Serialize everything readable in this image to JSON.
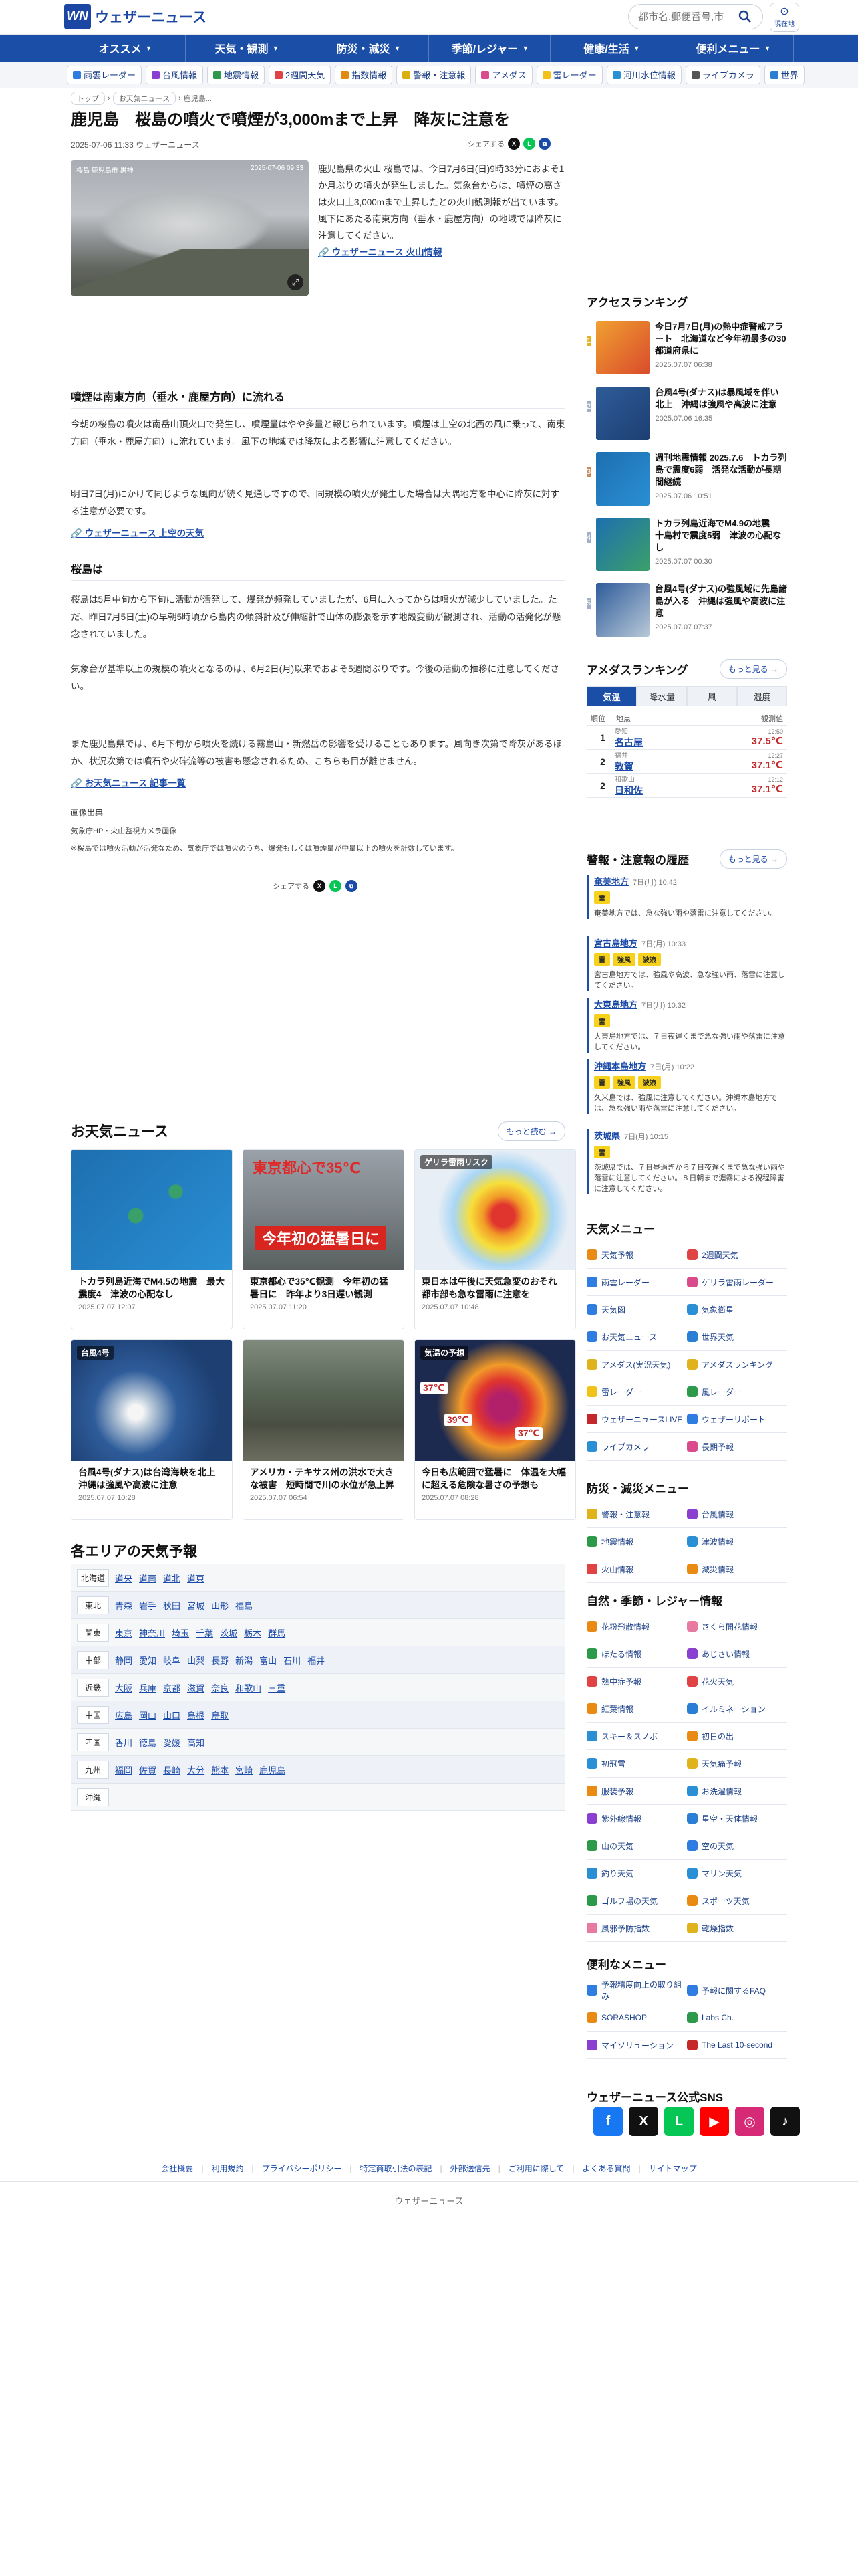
{
  "header": {
    "logo_mark": "WN",
    "logo_text": "ウェザーニュース",
    "search_placeholder": "都市名,郵便番号,市",
    "current_location_label": "現在地"
  },
  "nav": [
    "オススメ",
    "天気・観測",
    "防災・減災",
    "季節/レジャー",
    "健康/生活",
    "便利メニュー"
  ],
  "subnav": [
    {
      "label": "雨雲レーダー",
      "color": "#2f7de1"
    },
    {
      "label": "台風情報",
      "color": "#8a3fd1"
    },
    {
      "label": "地震情報",
      "color": "#2d9a4b"
    },
    {
      "label": "2週間天気",
      "color": "#e04343"
    },
    {
      "label": "指数情報",
      "color": "#e08a12"
    },
    {
      "label": "警報・注意報",
      "color": "#d9b00f"
    },
    {
      "label": "アメダス",
      "color": "#d94b8c"
    },
    {
      "label": "雷レーダー",
      "color": "#f2c21a"
    },
    {
      "label": "河川水位情報",
      "color": "#2a8fd4"
    },
    {
      "label": "ライブカメラ",
      "color": "#555555"
    },
    {
      "label": "世界",
      "color": "#2a7fd4"
    }
  ],
  "breadcrumb": [
    "トップ",
    "お天気ニュース",
    "鹿児島..."
  ],
  "article": {
    "title": "鹿児島　桜島の噴火で噴煙が3,000mまで上昇　降灰に注意を",
    "meta": "2025-07-06 11:33 ウェザーニュース",
    "share_label": "シェアする",
    "image_label": "桜島 鹿児島市 黒神",
    "image_time": "2025-07-06 09:33",
    "lead": "鹿児島県の火山 桜島では、今日7月6日(日)9時33分におよそ1か月ぶりの噴火が発生しました。気象台からは、噴煙の高さは火口上3,000mまで上昇したとの火山観測報が出ています。風下にあたる南東方向（垂水・鹿屋方向）の地域では降灰に注意してください。",
    "lead_link": "ウェザーニュース 火山情報",
    "section1_title": "噴煙は南東方向（垂水・鹿屋方向）に流れる",
    "section1_p1": "今朝の桜島の噴火は南岳山頂火口で発生し、噴煙量はやや多量と報じられています。噴煙は上空の北西の風に乗って、南東方向（垂水・鹿屋方向）に流れています。風下の地域では降灰による影響に注意してください。",
    "section1_p2": "明日7日(月)にかけて同じような風向が続く見通しですので、同規模の噴火が発生した場合は大隅地方を中心に降灰に対する注意が必要です。",
    "section1_link": "ウェザーニュース 上空の天気",
    "section2_title": "桜島は",
    "section2_p1": "桜島は5月中旬から下旬に活動が活発して、爆発が頻発していましたが、6月に入ってからは噴火が減少していました。ただ、昨日7月5日(土)の早朝5時頃から島内の傾斜計及び伸縮計で山体の膨張を示す地殻変動が観測され、活動の活発化が懸念されていました。",
    "section2_p2": "気象台が基準以上の規模の噴火となるのは、6月2日(月)以来でおよそ5週間ぶりです。今後の活動の推移に注意してください。",
    "section2_p3": "また鹿児島県では、6月下旬から噴火を続ける霧島山・新燃岳の影響を受けることもあります。風向き次第で降灰があるほか、状況次第では噴石や火砕流等の被害も懸念されるため、こちらも目が離せません。",
    "section2_link": "お天気ニュース 記事一覧",
    "credit_title": "画像出典",
    "credit": "気象庁HP・火山監視カメラ画像",
    "note": "※桜島では噴火活動が活発なため、気象庁では噴火のうち、爆発もしくは噴煙量が中量以上の噴火を計数しています。"
  },
  "news": {
    "title": "お天気ニュース",
    "more": "もっと読む",
    "items": [
      {
        "title": "トカラ列島近海でM4.5の地震　最大震度4　津波の心配なし",
        "date": "2025.07.07 12:07",
        "theme": "map"
      },
      {
        "title": "東京都心で35℃観測　今年初の猛暑日に　昨年より3日遅い観測",
        "date": "2025.07.07 11:20",
        "theme": "city",
        "overlay": "東京都心で35℃",
        "banner": "今年初の猛暑日に"
      },
      {
        "title": "東日本は午後に天気急変のおそれ　都市部も急な雷雨に注意を",
        "date": "2025.07.07 10:48",
        "theme": "rainmap",
        "overlay": "ゲリラ雷雨リスク"
      },
      {
        "title": "台風4号(ダナス)は台湾海峡を北上　沖縄は強風や高波に注意",
        "date": "2025.07.07 10:28",
        "theme": "typhoon",
        "overlay": "台風4号"
      },
      {
        "title": "アメリカ・テキサス州の洪水で大きな被害　短時間で川の水位が急上昇",
        "date": "2025.07.07 06:54",
        "theme": "flood"
      },
      {
        "title": "今日も広範囲で猛暑に　体温を大幅に超える危険な暑さの予想も",
        "date": "2025.07.07 08:28",
        "theme": "heatmap",
        "overlay": "気温の予想",
        "t1": "37℃",
        "t2": "39℃",
        "t3": "37℃"
      }
    ]
  },
  "areas": {
    "title": "各エリアの天気予報",
    "rows": [
      {
        "region": "北海道",
        "prefs": [
          "道央",
          "道南",
          "道北",
          "道東"
        ]
      },
      {
        "region": "東北",
        "prefs": [
          "青森",
          "岩手",
          "秋田",
          "宮城",
          "山形",
          "福島"
        ]
      },
      {
        "region": "関東",
        "prefs": [
          "東京",
          "神奈川",
          "埼玉",
          "千葉",
          "茨城",
          "栃木",
          "群馬"
        ]
      },
      {
        "region": "中部",
        "prefs": [
          "静岡",
          "愛知",
          "岐阜",
          "山梨",
          "長野",
          "新潟",
          "富山",
          "石川",
          "福井"
        ]
      },
      {
        "region": "近畿",
        "prefs": [
          "大阪",
          "兵庫",
          "京都",
          "滋賀",
          "奈良",
          "和歌山",
          "三重"
        ]
      },
      {
        "region": "中国",
        "prefs": [
          "広島",
          "岡山",
          "山口",
          "島根",
          "鳥取"
        ]
      },
      {
        "region": "四国",
        "prefs": [
          "香川",
          "徳島",
          "愛媛",
          "高知"
        ]
      },
      {
        "region": "九州",
        "prefs": [
          "福岡",
          "佐賀",
          "長崎",
          "大分",
          "熊本",
          "宮崎",
          "鹿児島"
        ]
      },
      {
        "region": "沖縄",
        "prefs": []
      }
    ]
  },
  "ranking": {
    "title": "アクセスランキング",
    "items": [
      {
        "rank": "1",
        "title": "今日7月7日(月)の熱中症警戒アラート　北海道など今年初最多の30都道府県に",
        "date": "2025.07.07 06:38",
        "color": "#e0b21b"
      },
      {
        "rank": "2",
        "title": "台風4号(ダナス)は暴風域を伴い北上　沖縄は強風や高波に注意",
        "date": "2025.07.06 16:35",
        "color": "#9fb0c8"
      },
      {
        "rank": "3",
        "title": "週刊地震情報 2025.7.6　トカラ列島で震度6弱　活発な活動が長期間継続",
        "date": "2025.07.06 10:51",
        "color": "#c98b5a"
      },
      {
        "rank": "4",
        "title": "トカラ列島近海でM4.9の地震　十島村で震度5弱　津波の心配なし",
        "date": "2025.07.07 00:30",
        "color": "#9fb0c8"
      },
      {
        "rank": "5",
        "title": "台風4号(ダナス)の強風域に先島諸島が入る　沖縄は強風や高波に注意",
        "date": "2025.07.07 07:37",
        "color": "#9fb0c8"
      }
    ]
  },
  "amedas": {
    "title": "アメダスランキング",
    "more": "もっと見る",
    "tabs": [
      "気温",
      "降水量",
      "風",
      "湿度"
    ],
    "head": [
      "順位",
      "地点",
      "観測値"
    ],
    "rows": [
      {
        "rank": "1",
        "pref": "愛知",
        "place": "名古屋",
        "time": "12:50",
        "value": "37.5℃"
      },
      {
        "rank": "2",
        "pref": "福井",
        "place": "敦賀",
        "time": "12:27",
        "value": "37.1℃"
      },
      {
        "rank": "2",
        "pref": "和歌山",
        "place": "日和佐",
        "time": "12:12",
        "value": "37.1℃"
      }
    ]
  },
  "warnings": {
    "title": "警報・注意報の履歴",
    "more": "もっと見る",
    "items": [
      {
        "area": "奄美地方",
        "time": "7日(月) 10:42",
        "badges": [
          "雷"
        ],
        "text": "奄美地方では、急な強い雨や落雷に注意してください。"
      },
      {
        "area": "宮古島地方",
        "time": "7日(月) 10:33",
        "badges": [
          "雷",
          "強風",
          "波浪"
        ],
        "text": "宮古島地方では、強風や高波、急な強い雨、落雷に注意してください。"
      },
      {
        "area": "大東島地方",
        "time": "7日(月) 10:32",
        "badges": [
          "雷"
        ],
        "text": "大東島地方では、７日夜遅くまで急な強い雨や落雷に注意してください。"
      },
      {
        "area": "沖縄本島地方",
        "time": "7日(月) 10:22",
        "badges": [
          "雷",
          "強風",
          "波浪"
        ],
        "text": "久米島では、強風に注意してください。沖縄本島地方では、急な強い雨や落雷に注意してください。"
      },
      {
        "area": "茨城県",
        "time": "7日(月) 10:15",
        "badges": [
          "雷"
        ],
        "text": "茨城県では、７日昼過ぎから７日夜遅くまで急な強い雨や落雷に注意してください。８日朝まで濃霧による視程障害に注意してください。"
      }
    ]
  },
  "menu_weather": {
    "title": "天気メニュー",
    "items": [
      {
        "label": "天気予報",
        "color": "#e98a12"
      },
      {
        "label": "2週間天気",
        "color": "#e04343"
      },
      {
        "label": "雨雲レーダー",
        "color": "#2f7de1"
      },
      {
        "label": "ゲリラ雷雨レーダー",
        "color": "#d94b8c"
      },
      {
        "label": "天気図",
        "color": "#2f7de1"
      },
      {
        "label": "気象衛星",
        "color": "#2a8fd4"
      },
      {
        "label": "お天気ニュース",
        "color": "#2f7de1"
      },
      {
        "label": "世界天気",
        "color": "#2a7fd4"
      },
      {
        "label": "アメダス(実況天気)",
        "color": "#e0b21b"
      },
      {
        "label": "アメダスランキング",
        "color": "#e0b21b"
      },
      {
        "label": "雷レーダー",
        "color": "#f2c21a"
      },
      {
        "label": "風レーダー",
        "color": "#2d9a4b"
      },
      {
        "label": "ウェザーニュースLIVE",
        "color": "#c4282a"
      },
      {
        "label": "ウェザーリポート",
        "color": "#2f7de1"
      },
      {
        "label": "ライブカメラ",
        "color": "#2a8fd4"
      },
      {
        "label": "長期予報",
        "color": "#d94b8c"
      }
    ]
  },
  "menu_disaster": {
    "title": "防災・減災メニュー",
    "items": [
      {
        "label": "警報・注意報",
        "color": "#e0b21b"
      },
      {
        "label": "台風情報",
        "color": "#8a3fd1"
      },
      {
        "label": "地震情報",
        "color": "#2d9a4b"
      },
      {
        "label": "津波情報",
        "color": "#2a8fd4"
      },
      {
        "label": "火山情報",
        "color": "#e04343"
      },
      {
        "label": "減災情報",
        "color": "#e98a12"
      }
    ]
  },
  "menu_leisure": {
    "title": "自然・季節・レジャー情報",
    "items": [
      {
        "label": "花粉飛散情報",
        "color": "#e98a12"
      },
      {
        "label": "さくら開花情報",
        "color": "#e779a2"
      },
      {
        "label": "ほたる情報",
        "color": "#2d9a4b"
      },
      {
        "label": "あじさい情報",
        "color": "#8a3fd1"
      },
      {
        "label": "熱中症予報",
        "color": "#e04343"
      },
      {
        "label": "花火天気",
        "color": "#e04343"
      },
      {
        "label": "紅葉情報",
        "color": "#e98a12"
      },
      {
        "label": "イルミネーション",
        "color": "#2a7fd4"
      },
      {
        "label": "スキー＆スノボ",
        "color": "#2a8fd4"
      },
      {
        "label": "初日の出",
        "color": "#e98a12"
      },
      {
        "label": "初冠雪",
        "color": "#2a8fd4"
      },
      {
        "label": "天気痛予報",
        "color": "#e0b21b"
      },
      {
        "label": "服装予報",
        "color": "#e98a12"
      },
      {
        "label": "お洗濯情報",
        "color": "#2a8fd4"
      },
      {
        "label": "紫外線情報",
        "color": "#8a3fd1"
      },
      {
        "label": "星空・天体情報",
        "color": "#2a7fd4"
      },
      {
        "label": "山の天気",
        "color": "#2d9a4b"
      },
      {
        "label": "空の天気",
        "color": "#2f7de1"
      },
      {
        "label": "釣り天気",
        "color": "#2a8fd4"
      },
      {
        "label": "マリン天気",
        "color": "#2a8fd4"
      },
      {
        "label": "ゴルフ場の天気",
        "color": "#2d9a4b"
      },
      {
        "label": "スポーツ天気",
        "color": "#e98a12"
      },
      {
        "label": "風邪予防指数",
        "color": "#e779a2"
      },
      {
        "label": "乾燥指数",
        "color": "#e0b21b"
      }
    ]
  },
  "menu_useful": {
    "title": "便利なメニュー",
    "items": [
      {
        "label": "予報精度向上の取り組み",
        "color": "#2f7de1"
      },
      {
        "label": "予報に関するFAQ",
        "color": "#2f7de1"
      },
      {
        "label": "SORASHOP",
        "color": "#e98a12"
      },
      {
        "label": "Labs Ch.",
        "color": "#2d9a4b"
      },
      {
        "label": "マイソリューション",
        "color": "#8a3fd1"
      },
      {
        "label": "The Last 10-second",
        "color": "#c4282a"
      }
    ]
  },
  "sns": {
    "title": "ウェザーニュース公式SNS",
    "items": [
      {
        "name": "facebook",
        "glyph": "f",
        "color": "#1877f2"
      },
      {
        "name": "x",
        "glyph": "X",
        "color": "#111111"
      },
      {
        "name": "line",
        "glyph": "L",
        "color": "#06c755"
      },
      {
        "name": "youtube",
        "glyph": "▶",
        "color": "#ff0000"
      },
      {
        "name": "instagram",
        "glyph": "◎",
        "color": "#d62976"
      },
      {
        "name": "tiktok",
        "glyph": "♪",
        "color": "#111111"
      }
    ]
  },
  "footer": {
    "links": [
      "会社概要",
      "利用規約",
      "プライバシーポリシー",
      "特定商取引法の表記",
      "外部送信先",
      "ご利用に際して",
      "よくある質問",
      "サイトマップ"
    ],
    "copyright": "ウェザーニュース"
  }
}
